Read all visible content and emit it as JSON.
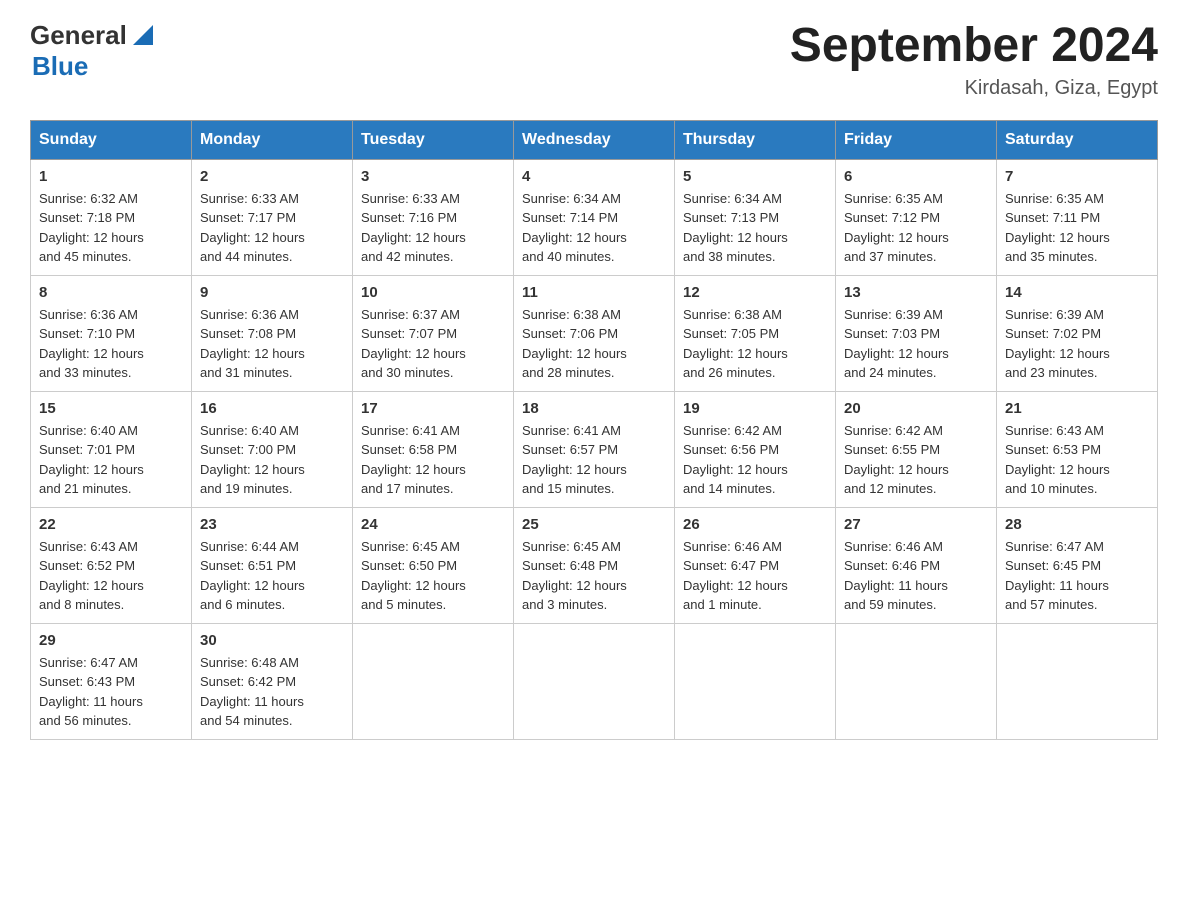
{
  "header": {
    "logo_general": "General",
    "logo_blue": "Blue",
    "month_title": "September 2024",
    "location": "Kirdasah, Giza, Egypt"
  },
  "days_of_week": [
    "Sunday",
    "Monday",
    "Tuesday",
    "Wednesday",
    "Thursday",
    "Friday",
    "Saturday"
  ],
  "weeks": [
    [
      {
        "day": "1",
        "sunrise": "6:32 AM",
        "sunset": "7:18 PM",
        "daylight": "12 hours and 45 minutes."
      },
      {
        "day": "2",
        "sunrise": "6:33 AM",
        "sunset": "7:17 PM",
        "daylight": "12 hours and 44 minutes."
      },
      {
        "day": "3",
        "sunrise": "6:33 AM",
        "sunset": "7:16 PM",
        "daylight": "12 hours and 42 minutes."
      },
      {
        "day": "4",
        "sunrise": "6:34 AM",
        "sunset": "7:14 PM",
        "daylight": "12 hours and 40 minutes."
      },
      {
        "day": "5",
        "sunrise": "6:34 AM",
        "sunset": "7:13 PM",
        "daylight": "12 hours and 38 minutes."
      },
      {
        "day": "6",
        "sunrise": "6:35 AM",
        "sunset": "7:12 PM",
        "daylight": "12 hours and 37 minutes."
      },
      {
        "day": "7",
        "sunrise": "6:35 AM",
        "sunset": "7:11 PM",
        "daylight": "12 hours and 35 minutes."
      }
    ],
    [
      {
        "day": "8",
        "sunrise": "6:36 AM",
        "sunset": "7:10 PM",
        "daylight": "12 hours and 33 minutes."
      },
      {
        "day": "9",
        "sunrise": "6:36 AM",
        "sunset": "7:08 PM",
        "daylight": "12 hours and 31 minutes."
      },
      {
        "day": "10",
        "sunrise": "6:37 AM",
        "sunset": "7:07 PM",
        "daylight": "12 hours and 30 minutes."
      },
      {
        "day": "11",
        "sunrise": "6:38 AM",
        "sunset": "7:06 PM",
        "daylight": "12 hours and 28 minutes."
      },
      {
        "day": "12",
        "sunrise": "6:38 AM",
        "sunset": "7:05 PM",
        "daylight": "12 hours and 26 minutes."
      },
      {
        "day": "13",
        "sunrise": "6:39 AM",
        "sunset": "7:03 PM",
        "daylight": "12 hours and 24 minutes."
      },
      {
        "day": "14",
        "sunrise": "6:39 AM",
        "sunset": "7:02 PM",
        "daylight": "12 hours and 23 minutes."
      }
    ],
    [
      {
        "day": "15",
        "sunrise": "6:40 AM",
        "sunset": "7:01 PM",
        "daylight": "12 hours and 21 minutes."
      },
      {
        "day": "16",
        "sunrise": "6:40 AM",
        "sunset": "7:00 PM",
        "daylight": "12 hours and 19 minutes."
      },
      {
        "day": "17",
        "sunrise": "6:41 AM",
        "sunset": "6:58 PM",
        "daylight": "12 hours and 17 minutes."
      },
      {
        "day": "18",
        "sunrise": "6:41 AM",
        "sunset": "6:57 PM",
        "daylight": "12 hours and 15 minutes."
      },
      {
        "day": "19",
        "sunrise": "6:42 AM",
        "sunset": "6:56 PM",
        "daylight": "12 hours and 14 minutes."
      },
      {
        "day": "20",
        "sunrise": "6:42 AM",
        "sunset": "6:55 PM",
        "daylight": "12 hours and 12 minutes."
      },
      {
        "day": "21",
        "sunrise": "6:43 AM",
        "sunset": "6:53 PM",
        "daylight": "12 hours and 10 minutes."
      }
    ],
    [
      {
        "day": "22",
        "sunrise": "6:43 AM",
        "sunset": "6:52 PM",
        "daylight": "12 hours and 8 minutes."
      },
      {
        "day": "23",
        "sunrise": "6:44 AM",
        "sunset": "6:51 PM",
        "daylight": "12 hours and 6 minutes."
      },
      {
        "day": "24",
        "sunrise": "6:45 AM",
        "sunset": "6:50 PM",
        "daylight": "12 hours and 5 minutes."
      },
      {
        "day": "25",
        "sunrise": "6:45 AM",
        "sunset": "6:48 PM",
        "daylight": "12 hours and 3 minutes."
      },
      {
        "day": "26",
        "sunrise": "6:46 AM",
        "sunset": "6:47 PM",
        "daylight": "12 hours and 1 minute."
      },
      {
        "day": "27",
        "sunrise": "6:46 AM",
        "sunset": "6:46 PM",
        "daylight": "11 hours and 59 minutes."
      },
      {
        "day": "28",
        "sunrise": "6:47 AM",
        "sunset": "6:45 PM",
        "daylight": "11 hours and 57 minutes."
      }
    ],
    [
      {
        "day": "29",
        "sunrise": "6:47 AM",
        "sunset": "6:43 PM",
        "daylight": "11 hours and 56 minutes."
      },
      {
        "day": "30",
        "sunrise": "6:48 AM",
        "sunset": "6:42 PM",
        "daylight": "11 hours and 54 minutes."
      },
      null,
      null,
      null,
      null,
      null
    ]
  ],
  "labels": {
    "sunrise": "Sunrise:",
    "sunset": "Sunset:",
    "daylight": "Daylight:"
  }
}
